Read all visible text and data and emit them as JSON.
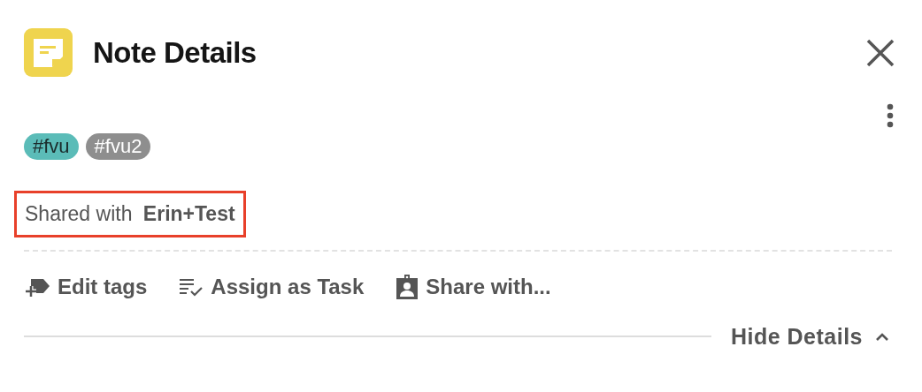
{
  "header": {
    "title": "Note Details"
  },
  "tags": [
    {
      "label": "#fvu",
      "color": "#5bbcb8"
    },
    {
      "label": "#fvu2",
      "color": "#8e8e8e"
    }
  ],
  "shared": {
    "label": "Shared with",
    "name": "Erin+Test",
    "highlighted": true
  },
  "actions": [
    {
      "kind": "tag",
      "label": "Edit tags"
    },
    {
      "kind": "task",
      "label": "Assign as Task"
    },
    {
      "kind": "share",
      "label": "Share with..."
    }
  ],
  "footer": {
    "label": "Hide Details",
    "expanded": true
  }
}
